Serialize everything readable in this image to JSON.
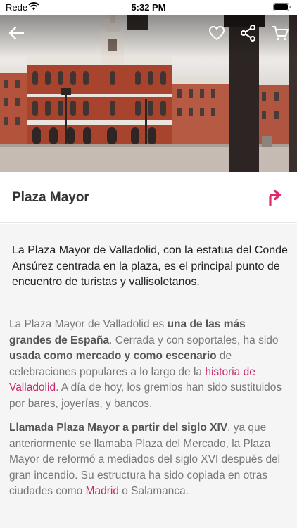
{
  "status_bar": {
    "carrier": "Rede",
    "time": "5:32 PM",
    "wifi_icon": "wifi-icon",
    "battery_icon": "battery-icon"
  },
  "toolbar": {
    "back_icon": "arrow-left-icon",
    "favorite_icon": "heart-icon",
    "share_icon": "share-icon",
    "cart_icon": "cart-icon"
  },
  "hero": {
    "image_alt": "Plaza Mayor photo"
  },
  "place": {
    "title": "Plaza Mayor",
    "directions_icon": "directions-arrow-icon",
    "directions_more": "···"
  },
  "summary": "La Plaza Mayor de Valladolid, con la estatua del Conde Ansúrez centrada en la plaza, es el principal punto de encuentro de turistas y vallisoletanos.",
  "paragraph1": {
    "t1": "La Plaza Mayor de Valladolid es ",
    "b1": "una de las más grandes de España",
    "t2": ". Cerrada y con soportales, ha sido ",
    "b2": "usada como mercado y como escenario",
    "t3": " de celebraciones populares a lo largo de la ",
    "link1": "historia de Valladolid",
    "t4": ". A día de hoy, los gremios han sido sustituidos por bares, joyerías, y bancos."
  },
  "paragraph2": {
    "b1": "Llamada Plaza Mayor a partir del siglo XIV",
    "t1": ", ya que anteriormente se llamaba Plaza del Mercado, la Plaza Mayor de reformó a mediados del siglo XVI después del gran incendio. Su estructura ha sido copiada en otras ciudades como ",
    "link1": "Madrid",
    "t2": " o Salamanca."
  },
  "colors": {
    "accent": "#e0286f",
    "link": "#c8276b",
    "body_text": "#777777",
    "title_text": "#333333"
  }
}
